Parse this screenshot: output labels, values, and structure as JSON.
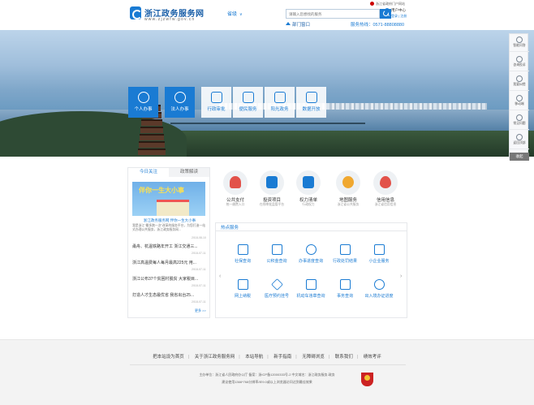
{
  "header": {
    "logo_title": "浙江政务服务网",
    "logo_url": "www.zjzwfw.gov.cn",
    "province": "省级",
    "search_placeholder": "请输入您想找的服务",
    "gov_top": "浙江省政府门户网站",
    "user_center": "用户中心",
    "user_links": "登录 | 注册",
    "dept_window": "部门窗口",
    "hotline": "服务热线：0571-88808880"
  },
  "categories": [
    {
      "label": "个人办事",
      "icon": "person-icon",
      "active": true
    },
    {
      "label": "法人办事",
      "icon": "company-icon",
      "active": true
    },
    {
      "label": "行政审批",
      "icon": "approval-icon",
      "active": false
    },
    {
      "label": "便民服务",
      "icon": "convenience-icon",
      "active": false
    },
    {
      "label": "阳光政务",
      "icon": "sunshine-icon",
      "active": false
    },
    {
      "label": "数据开放",
      "icon": "data-icon",
      "active": false
    }
  ],
  "right_sidebar": {
    "items": [
      {
        "label": "智能问答",
        "icon": "robot-icon"
      },
      {
        "label": "咨询投诉",
        "icon": "consult-icon"
      },
      {
        "label": "我要纠错",
        "icon": "correct-icon"
      },
      {
        "label": "移动端",
        "icon": "mobile-icon"
      },
      {
        "label": "常见问题",
        "icon": "faq-icon"
      },
      {
        "label": "返回顶部",
        "icon": "top-icon"
      }
    ],
    "bottom": "收起"
  },
  "news": {
    "tabs": [
      "今日关注",
      "政策解读"
    ],
    "image_caption": "伴你一生大小事",
    "headline": "浙江政务服务网 伴你一生大小事",
    "description": "我是浙江\"最多跑一次\"改革的服务平台，为您打造一站式办理公共服务，浙江政务服务网...",
    "headline_date": "2018-08-10",
    "items": [
      {
        "title": "甬舟、杭温铁路年开工 浙江交通三...",
        "date": "2018-07-11"
      },
      {
        "title": "浙江高温费每人每月最高225元 用...",
        "date": "2018-07-11"
      },
      {
        "title": "浙江公布37个贫困村脱贫 大家税目...",
        "date": "2018-07-11"
      },
      {
        "title": "打造人才生态最优省 我省出台25...",
        "date": "2018-07-11"
      }
    ],
    "more": "更多 >>"
  },
  "quick_services": [
    {
      "label": "公共支付",
      "sub": "统一缴费入口",
      "icon": "payment-icon",
      "color": "#e2524a"
    },
    {
      "label": "投资项目",
      "sub": "在线审批监管平台",
      "icon": "project-icon",
      "color": "#1a7bd3"
    },
    {
      "label": "权力清单",
      "sub": "行政权力",
      "icon": "power-list-icon",
      "color": "#1a7bd3"
    },
    {
      "label": "地图服务",
      "sub": "浙江省公共服务",
      "icon": "map-icon",
      "color": "#f0a830"
    },
    {
      "label": "信用信息",
      "sub": "浙江省信用信息",
      "icon": "credit-icon",
      "color": "#e2524a"
    }
  ],
  "hot_services": {
    "title": "热点服务",
    "items": [
      {
        "label": "社保查询",
        "icon": "social-security-icon"
      },
      {
        "label": "公积金查询",
        "icon": "housing-fund-icon"
      },
      {
        "label": "办事进度查询",
        "icon": "progress-icon"
      },
      {
        "label": "行政处罚结果",
        "icon": "penalty-icon"
      },
      {
        "label": "小企业服务",
        "icon": "enterprise-icon"
      },
      {
        "label": "网上纳税",
        "icon": "tax-icon"
      },
      {
        "label": "医疗预约挂号",
        "icon": "medical-icon"
      },
      {
        "label": "机动车违章查询",
        "icon": "vehicle-icon"
      },
      {
        "label": "事务查询",
        "icon": "affairs-icon"
      },
      {
        "label": "出入境办证进度",
        "icon": "exit-entry-icon"
      }
    ]
  },
  "footer": {
    "links": [
      "把本站设为首页",
      "关于浙江政务服务网",
      "本站导航",
      "新手指南",
      "无障碍浏览",
      "联系我们",
      "绩效考评"
    ],
    "org": "主办单位：浙江省人民政府办公厅  备案：浙ICP备12000333号-2  中文域名：浙江政务服务.政务",
    "tip": "建议使用1366*768分辨率/IE9.0或以上浏览器访问达到最佳效果"
  }
}
